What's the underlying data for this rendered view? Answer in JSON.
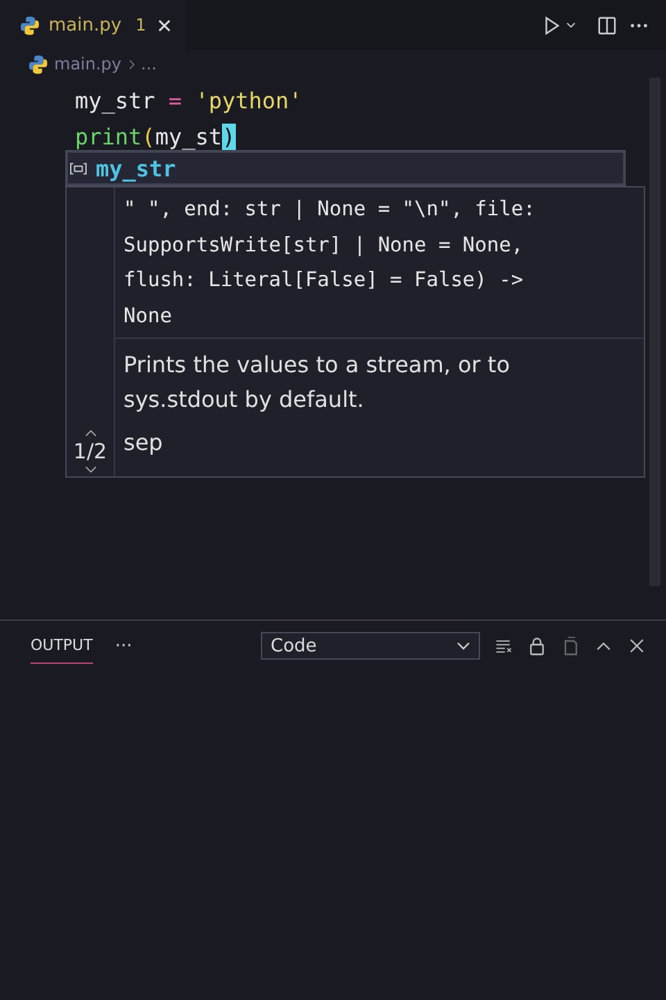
{
  "tabs": [
    {
      "label": "main.py",
      "badge": "1",
      "selected": true
    }
  ],
  "breadcrumb": [
    "main.py",
    "..."
  ],
  "code": [
    [
      {
        "kind": "var",
        "text": "my_str"
      },
      {
        "kind": "op",
        "text": " = "
      },
      {
        "kind": "string",
        "text": "'python'"
      }
    ],
    [
      {
        "kind": "func",
        "text": "print"
      },
      {
        "kind": "paren",
        "text": "("
      },
      {
        "kind": "var",
        "text": "my_st"
      },
      {
        "kind": "cursor",
        "text": ")"
      }
    ]
  ],
  "suggestions": [
    {
      "label": "my_str",
      "selected": true
    }
  ],
  "hover": {
    "signature": [
      "\" \", end: str | None = \"\\n\", file:",
      "SupportsWrite[str] | None = None,",
      "flush: Literal[False] = False) ->",
      "None"
    ],
    "doc": "Prints the values to a stream, or to sys.stdout by default.",
    "page": "1/2",
    "param": "sep"
  },
  "panel": {
    "tabs": [
      {
        "label": "OUTPUT",
        "selected": true
      }
    ],
    "more": "···",
    "dropdown": "Code"
  }
}
